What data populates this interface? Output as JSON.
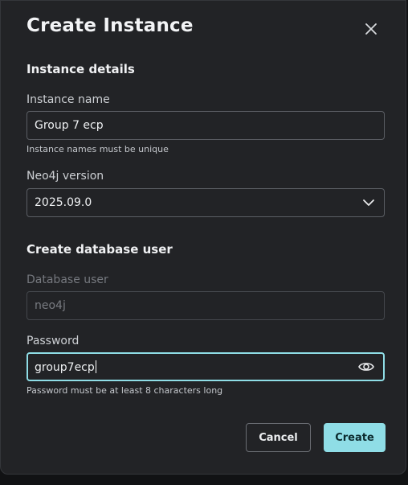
{
  "dialog": {
    "title": "Create Instance",
    "close_icon": "close-icon"
  },
  "instance_details": {
    "section_title": "Instance details",
    "name_label": "Instance name",
    "name_value": "Group 7 ecp",
    "name_helper": "Instance names must be unique",
    "version_label": "Neo4j version",
    "version_value": "2025.09.0",
    "version_icon": "chevron-down-icon"
  },
  "database_user": {
    "section_title": "Create database user",
    "user_label": "Database user",
    "user_value": "neo4j",
    "password_label": "Password",
    "password_value": "group7ecp",
    "password_icon": "eye-icon",
    "password_helper": "Password must be at least 8 characters long"
  },
  "actions": {
    "cancel_label": "Cancel",
    "create_label": "Create"
  },
  "colors": {
    "accent": "#8fdde6",
    "background": "#222326"
  }
}
